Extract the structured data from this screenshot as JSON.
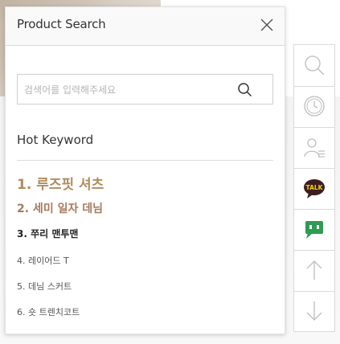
{
  "panel": {
    "title": "Product Search",
    "search": {
      "placeholder": "검색어를 입력해주세요",
      "value": ""
    },
    "hot_title": "Hot Keyword",
    "keywords": [
      "1. 루즈핏 셔츠",
      "2. 세미 일자 데님",
      "3. 쭈리 맨투맨",
      "4. 레이어드 T",
      "5. 데님 스커트",
      "6. 숏 트렌치코트"
    ]
  },
  "quickbar": {
    "items": [
      "search-icon",
      "clock-icon",
      "user-list-icon",
      "kakao-talk-icon",
      "chat-icon",
      "arrow-up-icon",
      "arrow-down-icon"
    ],
    "talk_label": "TALK"
  },
  "colors": {
    "accent_gold": "#b08d5e",
    "accent_brown": "#a87a5c",
    "kakao_brown": "#3c1e1e",
    "chat_green": "#2e9c52",
    "icon_gray": "#bdbdbd"
  }
}
